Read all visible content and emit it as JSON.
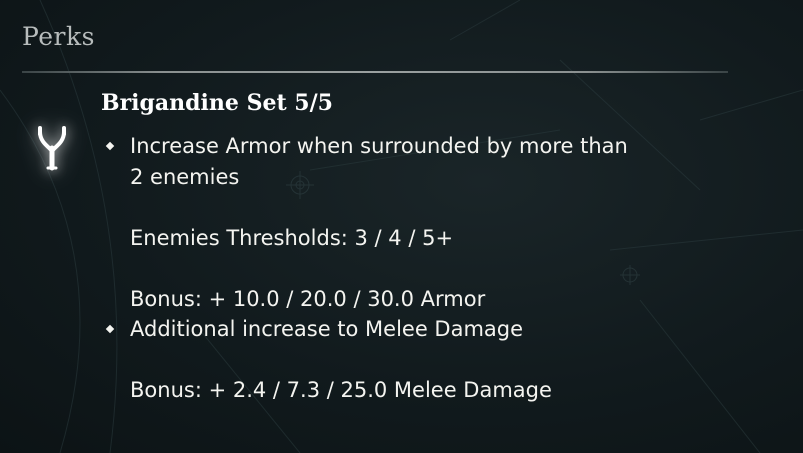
{
  "section_title": "Perks",
  "perk": {
    "icon": "brigandine-rune-icon",
    "name": "Brigandine Set 5/5",
    "effects": [
      {
        "lines": [
          "Increase Armor when surrounded by more than",
          "2 enemies",
          "",
          "Enemies Thresholds: 3 / 4 / 5+",
          "",
          "Bonus: + 10.0 / 20.0 / 30.0 Armor"
        ]
      },
      {
        "lines": [
          "Additional increase to Melee Damage",
          "",
          "Bonus: + 2.4 / 7.3 / 25.0 Melee Damage"
        ]
      }
    ]
  },
  "colors": {
    "background": "#121b1e",
    "title": "#b7bcbc",
    "text": "#f4f4f0"
  }
}
